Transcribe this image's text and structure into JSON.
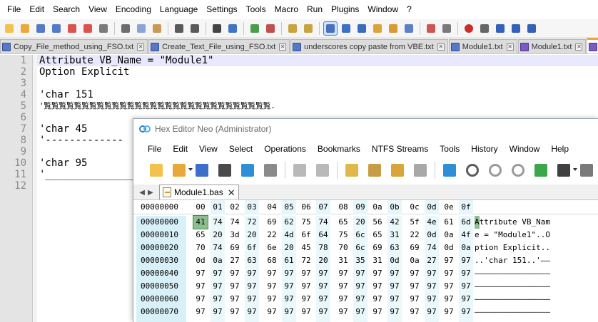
{
  "npp": {
    "menu": [
      "File",
      "Edit",
      "Search",
      "View",
      "Encoding",
      "Language",
      "Settings",
      "Tools",
      "Macro",
      "Run",
      "Plugins",
      "Window",
      "?"
    ],
    "toolbar_icons": [
      "new-file-icon",
      "open-file-icon",
      "save-icon",
      "save-all-icon",
      "close-icon",
      "close-all-icon",
      "print-icon",
      "cut-icon",
      "copy-icon",
      "paste-icon",
      "undo-icon",
      "redo-icon",
      "find-icon",
      "replace-icon",
      "zoom-in-icon",
      "zoom-out-icon",
      "sync-v-icon",
      "sync-h-icon",
      "word-wrap-icon",
      "show-all-chars-icon",
      "indent-guide-icon",
      "lang-icon",
      "doc-map-icon",
      "func-list-icon",
      "folder-workspace-icon",
      "monitor-icon",
      "record-macro-icon",
      "stop-macro-icon",
      "play-macro-icon",
      "run-macro-icon",
      "save-macro-icon"
    ],
    "tabs": [
      {
        "label": "Copy_File_method_using_FSO.txt",
        "icon": "file-icon"
      },
      {
        "label": "Create_Text_File_using_FSO.txt",
        "icon": "file-icon"
      },
      {
        "label": "underscores copy paste from VBE.txt",
        "icon": "file-icon"
      },
      {
        "label": "Module1.txt",
        "icon": "file-icon"
      },
      {
        "label": "Module1.txt",
        "icon": "file-icon"
      },
      {
        "label": "Modu",
        "icon": "file-icon",
        "active": true
      }
    ],
    "line_numbers": [
      "1",
      "2",
      "3",
      "4",
      "5",
      "6",
      "7",
      "8",
      "9",
      "10",
      "11",
      "12"
    ],
    "lines": [
      "Attribute VB_Name = \"Module1\"",
      "Option Explicit",
      "",
      "'char 151",
      "'覧覧覧覧覧覧覧覧覧覧覧覧覧覧覧覧覧覧覧覧覧覧覧覧覧覧覧覧覧覧.",
      "",
      "'char 45",
      "'-------------",
      "",
      "'char 95",
      "'_____________________",
      ""
    ]
  },
  "hex": {
    "title": "Hex Editor Neo (Administrator)",
    "menu": [
      "File",
      "Edit",
      "View",
      "Select",
      "Operations",
      "Bookmarks",
      "NTFS Streams",
      "Tools",
      "History",
      "Window",
      "Help"
    ],
    "toolbar_icons": [
      "new-icon",
      "open-icon",
      "save-icon",
      "save-as-icon",
      "save-all-icon",
      "print-icon",
      "undo-icon",
      "redo-icon",
      "edit-icon",
      "copy-icon",
      "paste-icon",
      "paste-special-icon",
      "export-icon",
      "find-icon",
      "find-next-icon",
      "find-prev-icon",
      "goto-icon",
      "base-icon",
      "tools-icon"
    ],
    "tab_label": "Module1.bas",
    "header_addr": "00000000",
    "columns": [
      "00",
      "01",
      "02",
      "03",
      "04",
      "05",
      "06",
      "07",
      "08",
      "09",
      "0a",
      "0b",
      "0c",
      "0d",
      "0e",
      "0f"
    ],
    "rows": [
      {
        "addr": "00000000",
        "bytes": [
          "41",
          "74",
          "74",
          "72",
          "69",
          "62",
          "75",
          "74",
          "65",
          "20",
          "56",
          "42",
          "5f",
          "4e",
          "61",
          "6d"
        ],
        "ascii": "Attribute VB_Nam"
      },
      {
        "addr": "00000010",
        "bytes": [
          "65",
          "20",
          "3d",
          "20",
          "22",
          "4d",
          "6f",
          "64",
          "75",
          "6c",
          "65",
          "31",
          "22",
          "0d",
          "0a",
          "4f"
        ],
        "ascii": "e = \"Module1\"..O"
      },
      {
        "addr": "00000020",
        "bytes": [
          "70",
          "74",
          "69",
          "6f",
          "6e",
          "20",
          "45",
          "78",
          "70",
          "6c",
          "69",
          "63",
          "69",
          "74",
          "0d",
          "0a"
        ],
        "ascii": "ption Explicit.."
      },
      {
        "addr": "00000030",
        "bytes": [
          "0d",
          "0a",
          "27",
          "63",
          "68",
          "61",
          "72",
          "20",
          "31",
          "35",
          "31",
          "0d",
          "0a",
          "27",
          "97",
          "97"
        ],
        "ascii": "..'char 151..'——"
      },
      {
        "addr": "00000040",
        "bytes": [
          "97",
          "97",
          "97",
          "97",
          "97",
          "97",
          "97",
          "97",
          "97",
          "97",
          "97",
          "97",
          "97",
          "97",
          "97",
          "97"
        ],
        "ascii": "————————————————"
      },
      {
        "addr": "00000050",
        "bytes": [
          "97",
          "97",
          "97",
          "97",
          "97",
          "97",
          "97",
          "97",
          "97",
          "97",
          "97",
          "97",
          "97",
          "97",
          "97",
          "97"
        ],
        "ascii": "————————————————"
      },
      {
        "addr": "00000060",
        "bytes": [
          "97",
          "97",
          "97",
          "97",
          "97",
          "97",
          "97",
          "97",
          "97",
          "97",
          "97",
          "97",
          "97",
          "97",
          "97",
          "97"
        ],
        "ascii": "————————————————"
      },
      {
        "addr": "00000070",
        "bytes": [
          "97",
          "97",
          "97",
          "97",
          "97",
          "97",
          "97",
          "97",
          "97",
          "97",
          "97",
          "97",
          "97",
          "97",
          "97",
          "97"
        ],
        "ascii": "————————————————"
      }
    ]
  },
  "colors": {
    "active_tab_accent": "#f3a33b",
    "hex_address_bg": "#d8f1f8",
    "hex_cursor": "#8cbf8f",
    "toolbar_selected": "#cde2fb"
  }
}
